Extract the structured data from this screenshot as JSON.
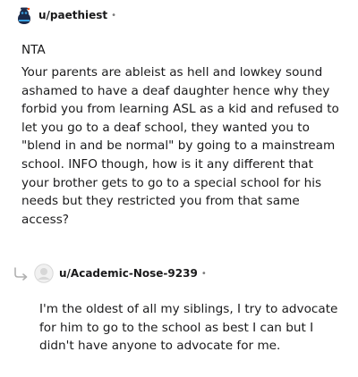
{
  "comments": [
    {
      "username": "u/paethiest",
      "separator": "•",
      "verdict": "NTA",
      "body": "Your parents are ableist as hell and lowkey sound ashamed to have a deaf daughter hence why they forbid you from learning ASL as a kid and refused to let you go to a deaf school, they wanted you to \"blend in and be normal\" by going to a mainstream school. INFO though, how is it any different that your brother gets to go to a special school for his needs but they restricted you from that same access?",
      "avatar_icon": "snoo-avatar-icon"
    },
    {
      "username": "u/Academic-Nose-9239",
      "separator": "•",
      "body": "I'm the oldest of all my siblings, I try to advocate for him to go to the school as best I can but I didn't have anyone to advocate for me.",
      "avatar_icon": "default-avatar-icon",
      "reply_icon": "reply-arrow-icon"
    }
  ],
  "colors": {
    "text": "#1a1a1b",
    "meta": "#7c7c7c",
    "avatar_dark": "#1b2a4a",
    "avatar_accent": "#3aa0e0",
    "default_avatar": "#d7d7d7"
  }
}
